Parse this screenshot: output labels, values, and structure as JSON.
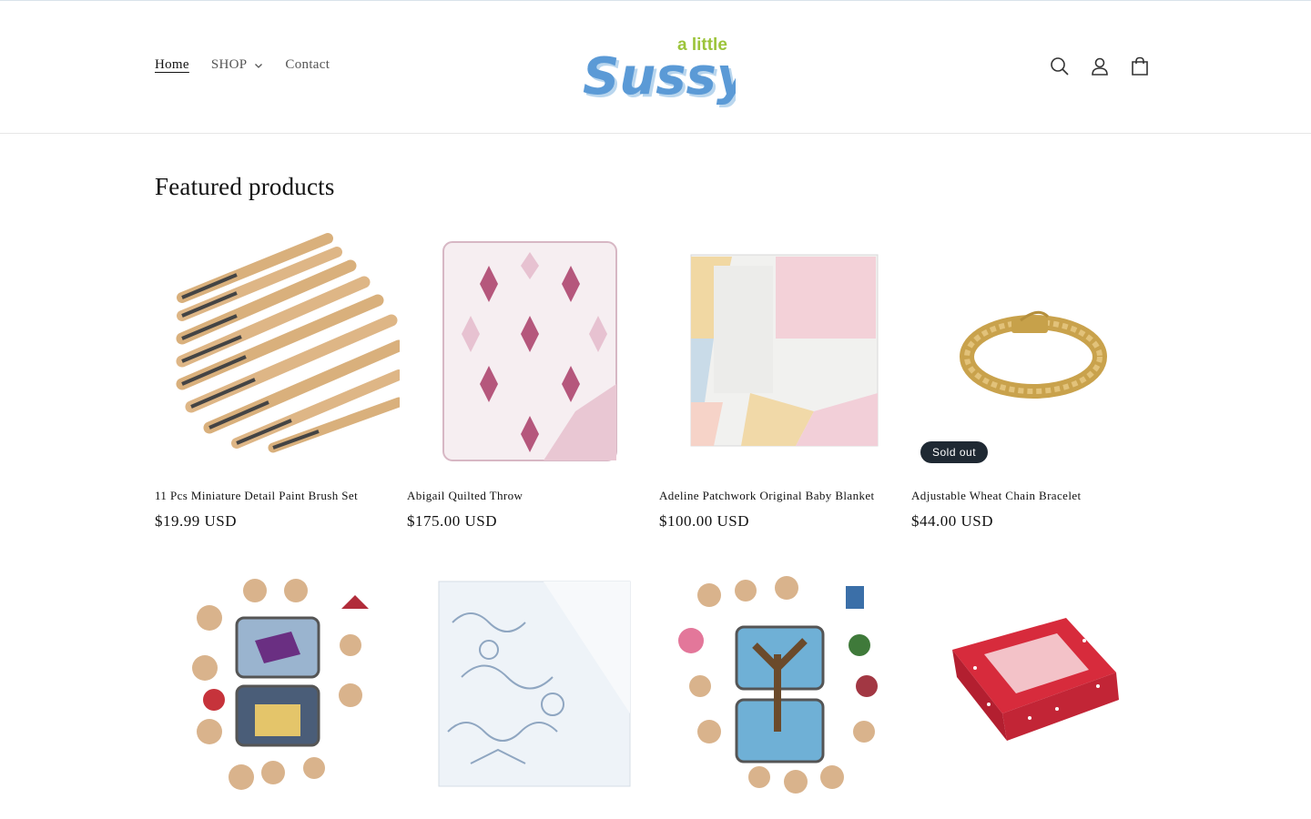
{
  "header": {
    "nav": [
      {
        "label": "Home"
      },
      {
        "label": "SHOP"
      },
      {
        "label": "Contact"
      }
    ],
    "logo": {
      "small_text": "a little",
      "big_text": "Sussy"
    },
    "icons": [
      "search-icon",
      "account-icon",
      "cart-icon"
    ]
  },
  "featured": {
    "title": "Featured products",
    "products": [
      {
        "title": "11 Pcs Miniature Detail Paint Brush Set",
        "price": "$19.99 USD",
        "badge": ""
      },
      {
        "title": "Abigail Quilted Throw",
        "price": "$175.00 USD",
        "badge": ""
      },
      {
        "title": "Adeline Patchwork Original Baby Blanket",
        "price": "$100.00 USD",
        "badge": ""
      },
      {
        "title": "Adjustable Wheat Chain Bracelet",
        "price": "$44.00 USD",
        "badge": "Sold out"
      },
      {
        "title": "",
        "price": "",
        "badge": ""
      },
      {
        "title": "",
        "price": "",
        "badge": ""
      },
      {
        "title": "",
        "price": "",
        "badge": ""
      },
      {
        "title": "",
        "price": "",
        "badge": ""
      }
    ]
  },
  "colors": {
    "logo_blue": "#5b9ad6",
    "logo_green": "#9cc43a",
    "badge": "#1f2933",
    "text": "#121212"
  }
}
